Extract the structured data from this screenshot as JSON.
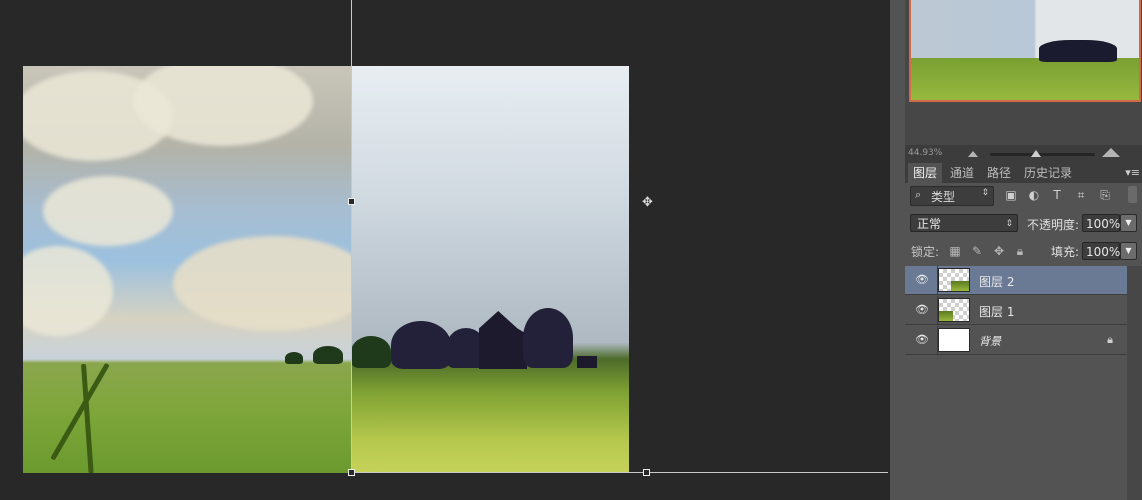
{
  "navigator": {
    "zoom": "44.93%",
    "zoom_out_icon": "small-mountain-icon",
    "zoom_in_icon": "large-mountain-icon"
  },
  "tabs": [
    {
      "label": "图层",
      "active": true
    },
    {
      "label": "通道",
      "active": false
    },
    {
      "label": "路径",
      "active": false
    },
    {
      "label": "历史记录",
      "active": false
    }
  ],
  "filter": {
    "search_icon": "search-icon",
    "kind_label": "类型",
    "icons": [
      "image-filter-icon",
      "adjustment-filter-icon",
      "type-filter-icon",
      "shape-filter-icon",
      "smart-object-filter-icon"
    ]
  },
  "blend": {
    "mode": "正常",
    "opacity_label": "不透明度:",
    "opacity_value": "100%"
  },
  "lock": {
    "label": "锁定:",
    "fill_label": "填充:",
    "fill_value": "100%"
  },
  "layers": [
    {
      "name": "图层 2",
      "selected": true,
      "thumb": "checker"
    },
    {
      "name": "图层 1",
      "selected": false,
      "thumb": "checker"
    },
    {
      "name": "背景",
      "selected": false,
      "thumb": "white",
      "locked": true
    }
  ],
  "colors": {
    "accent_selected": "#6a7a94",
    "navigator_border": "#d16a4a",
    "panel_bg": "#535353",
    "canvas_bg": "#282828"
  }
}
